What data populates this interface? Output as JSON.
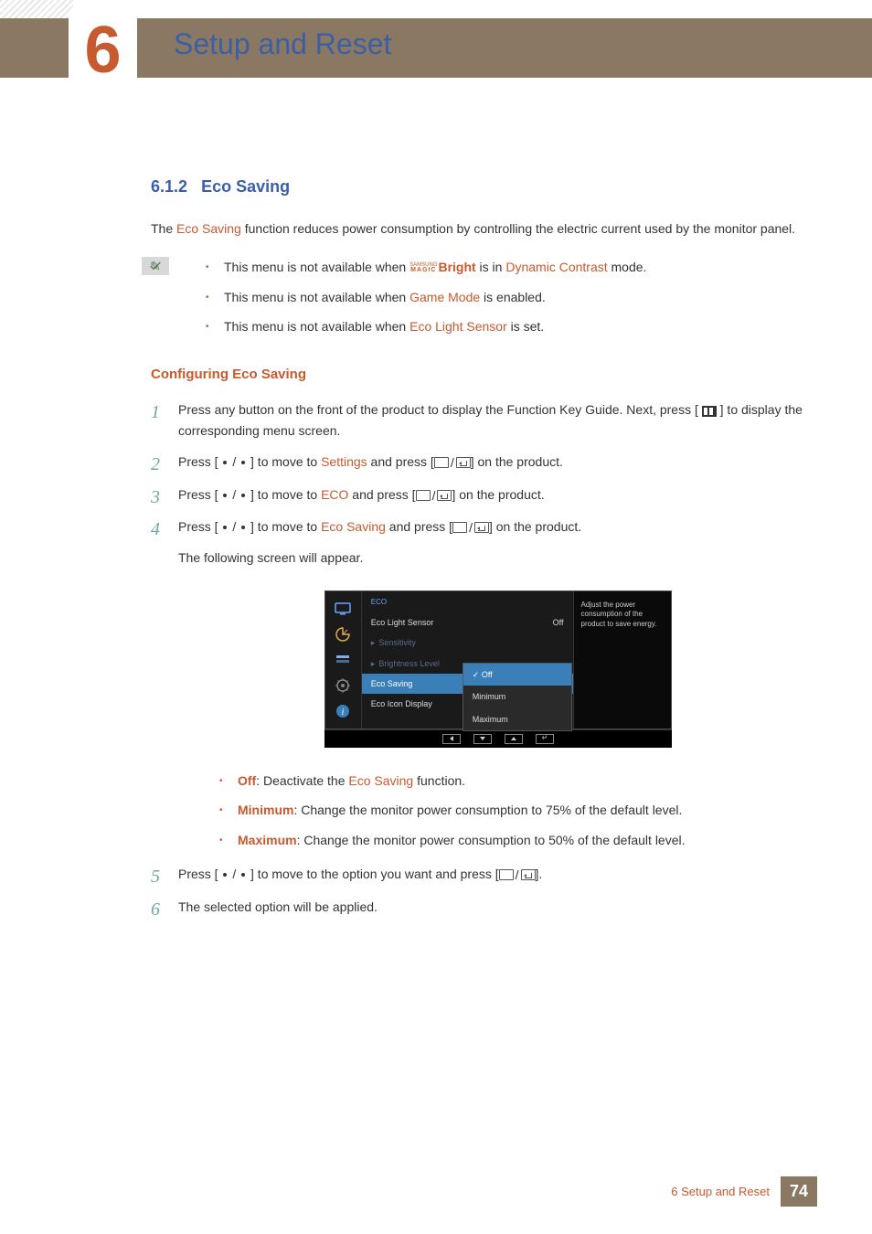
{
  "chapter": {
    "num": "6",
    "title": "Setup and Reset"
  },
  "section": {
    "num": "6.1.2",
    "title": "Eco Saving"
  },
  "intro": {
    "pre": "The ",
    "term": "Eco Saving",
    "post": " function reduces power consumption by controlling the electric current used by the monitor panel."
  },
  "notes": {
    "n1_pre": "This menu is not available when ",
    "n1_bright": "Bright",
    "n1_mid": " is in ",
    "n1_mode": "Dynamic Contrast",
    "n1_post": " mode.",
    "n2_pre": "This menu is not available when ",
    "n2_term": "Game Mode",
    "n2_post": " is enabled.",
    "n3_pre": "This menu is not available when ",
    "n3_term": "Eco Light Sensor",
    "n3_post": " is set."
  },
  "subhead": "Configuring Eco Saving",
  "steps": {
    "s1_a": "Press any button on the front of the product to display the Function Key Guide. Next, press [ ",
    "s1_b": " ] to display the corresponding menu screen.",
    "s2_a": "Press [ ",
    "s2_b": " ] to move to ",
    "s2_term": "Settings",
    "s2_c": " and press [",
    "s2_d": "] on the product.",
    "s3_a": "Press [ ",
    "s3_b": " ] to move to ",
    "s3_term": "ECO",
    "s3_c": " and press [",
    "s3_d": "] on the product.",
    "s4_a": "Press [ ",
    "s4_b": " ] to move to ",
    "s4_term": "Eco Saving",
    "s4_c": " and press [",
    "s4_d": "] on the product.",
    "s4_follow": "The following screen will appear.",
    "s5_a": "Press [ ",
    "s5_b": " ] to move to the option you want and press [",
    "s5_c": "].",
    "s6": "The selected option will be applied."
  },
  "options": {
    "off_label": "Off",
    "off_text": ": Deactivate the ",
    "off_term": "Eco Saving",
    "off_post": " function.",
    "min_label": "Minimum",
    "min_text": ": Change the monitor power consumption to 75% of the default level.",
    "max_label": "Maximum",
    "max_text": ": Change the monitor power consumption to 50% of the default level."
  },
  "osd": {
    "crumb": "ECO",
    "r1_label": "Eco Light Sensor",
    "r1_val": "Off",
    "r2_label": "Sensitivity",
    "r3_label": "Brightness Level",
    "r4_label": "Eco Saving",
    "r5_label": "Eco Icon Display",
    "opt1": "Off",
    "opt2": "Minimum",
    "opt3": "Maximum",
    "help": "Adjust the power consumption of the product to save energy."
  },
  "footer": {
    "text": "6 Setup and Reset",
    "page": "74"
  }
}
